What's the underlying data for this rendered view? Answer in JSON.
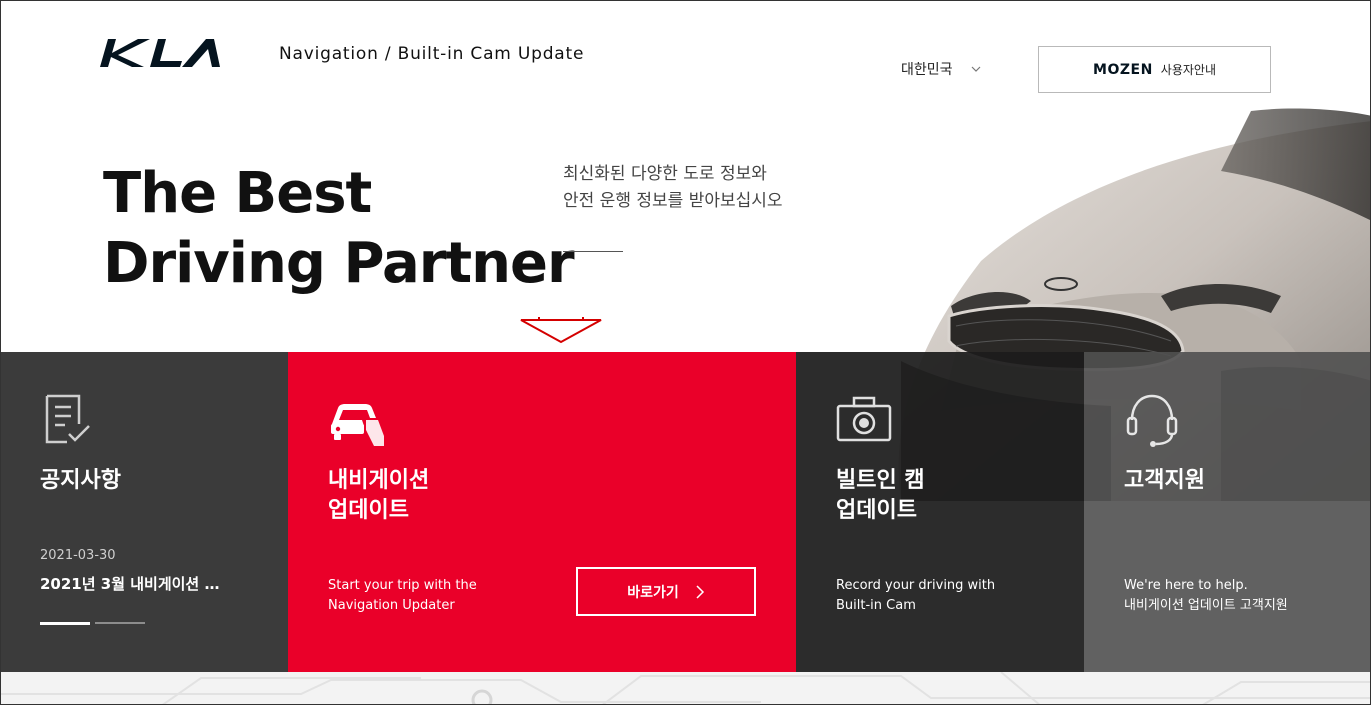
{
  "header": {
    "site_title": "Navigation / Built-in Cam Update",
    "country": "대한민국",
    "guide_brand": "MOZEN",
    "guide_label": "사용자안내"
  },
  "hero": {
    "title_line1": "The Best",
    "title_line2": "Driving Partner",
    "desc_line1": "최신화된 다양한 도로 정보와",
    "desc_line2": "안전 운행 정보를 받아보십시오"
  },
  "panels": {
    "notice": {
      "title": "공지사항",
      "date": "2021-03-30",
      "headline": "2021년 3월 내비게이션 …"
    },
    "navigation": {
      "title_line1": "내비게이션",
      "title_line2": "업데이트",
      "text_line1": "Start your trip with the",
      "text_line2": "Navigation Updater",
      "button_label": "바로가기"
    },
    "camera": {
      "title_line1": "빌트인 캠",
      "title_line2": "업데이트",
      "text_line1": "Record your driving with",
      "text_line2": "Built-in Cam"
    },
    "support": {
      "title": "고객지원",
      "text_line1": "We're here to help.",
      "text_line2": "내비게이션 업데이트 고객지원"
    }
  },
  "colors": {
    "brand_red": "#ea0029",
    "dark_panel": "#3b3b3b",
    "logo": "#05141f"
  },
  "icons": {
    "notice": "checklist-icon",
    "navigation": "car-update-icon",
    "camera": "camera-icon",
    "support": "headset-icon",
    "hero": "down-arrow-icon"
  }
}
